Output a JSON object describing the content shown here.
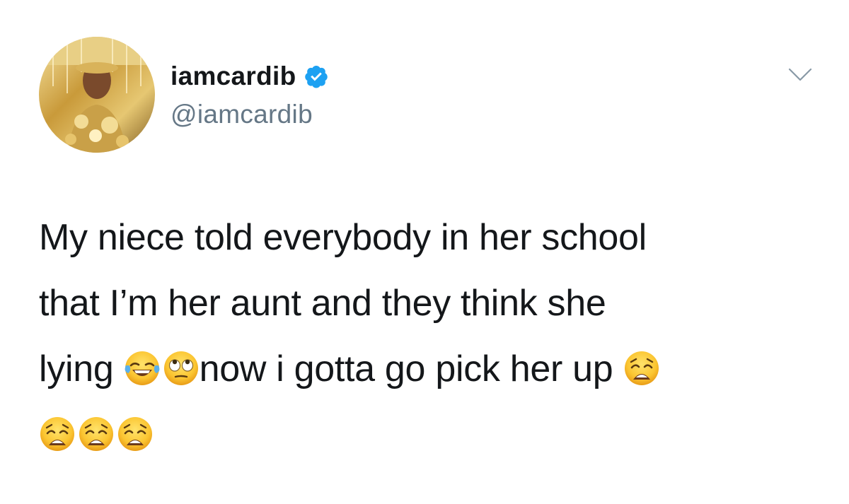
{
  "user": {
    "display_name": "iamcardib",
    "handle": "@iamcardib",
    "verified": true
  },
  "tweet": {
    "line1": "My niece told everybody in her school",
    "line2": "that I’m her aunt and they think she",
    "line3_start": "lying ",
    "line3_middle": "now i gotta go pick her up ",
    "emojis": [
      "face-with-tears-of-joy",
      "face-with-rolling-eyes",
      "weary-face",
      "weary-face",
      "weary-face",
      "weary-face"
    ]
  },
  "icons": {
    "verified": "verified-badge-icon",
    "menu": "chevron-down-icon"
  },
  "colors": {
    "verified_blue": "#1da1f2",
    "handle_gray": "#657786",
    "text": "#14171a",
    "chevron": "#8899a6"
  }
}
